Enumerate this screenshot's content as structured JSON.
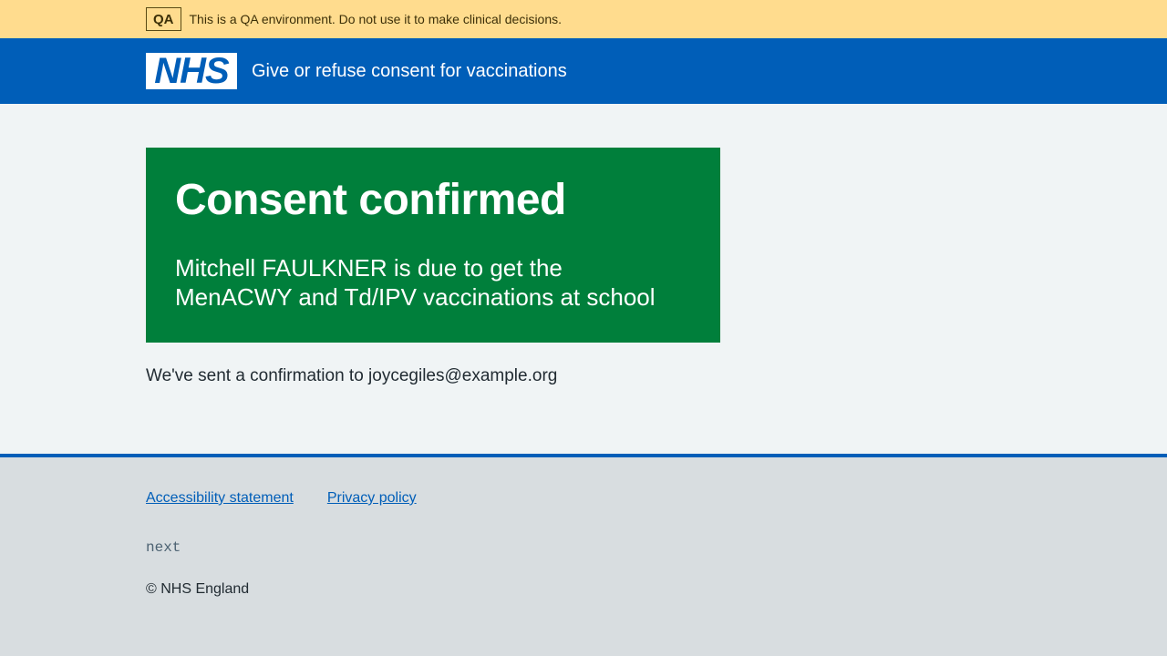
{
  "environment_banner": {
    "tag": "QA",
    "message": "This is a QA environment. Do not use it to make clinical decisions."
  },
  "header": {
    "logo_text": "NHS",
    "service_name": "Give or refuse consent for vaccinations"
  },
  "panel": {
    "title": "Consent confirmed",
    "body": "Mitchell FAULKNER is due to get the MenACWY and Td/IPV vaccinations at school"
  },
  "confirmation": "We've sent a confirmation to joycegiles@example.org",
  "footer": {
    "links": [
      {
        "label": "Accessibility statement"
      },
      {
        "label": "Privacy policy"
      }
    ],
    "version": "next",
    "copyright": "© NHS England"
  },
  "colors": {
    "banner_bg": "#ffdc8e",
    "header_bg": "#005eb8",
    "panel_bg": "#007f3b",
    "page_bg": "#f0f4f5",
    "footer_bg": "#d8dde0"
  }
}
